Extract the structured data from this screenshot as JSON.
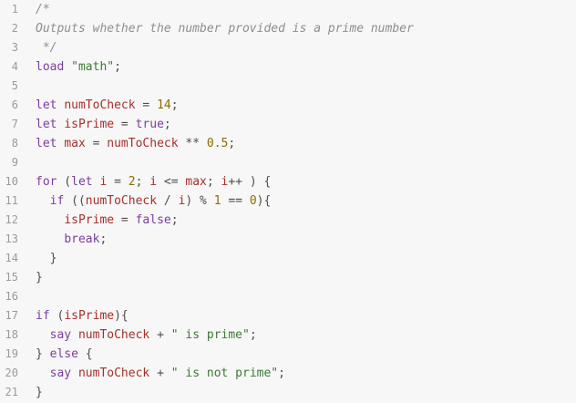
{
  "editor": {
    "lines": [
      {
        "num": "1",
        "tokens": [
          {
            "t": "comment",
            "v": "/*"
          }
        ]
      },
      {
        "num": "2",
        "tokens": [
          {
            "t": "comment",
            "v": "Outputs whether the number provided is a prime number"
          }
        ]
      },
      {
        "num": "3",
        "tokens": [
          {
            "t": "comment",
            "v": " */"
          }
        ]
      },
      {
        "num": "4",
        "tokens": [
          {
            "t": "keyword",
            "v": "load"
          },
          {
            "t": "punct",
            "v": " "
          },
          {
            "t": "string",
            "v": "\"math\""
          },
          {
            "t": "punct",
            "v": ";"
          }
        ]
      },
      {
        "num": "5",
        "tokens": []
      },
      {
        "num": "6",
        "tokens": [
          {
            "t": "keyword",
            "v": "let"
          },
          {
            "t": "punct",
            "v": " "
          },
          {
            "t": "var",
            "v": "numToCheck"
          },
          {
            "t": "op",
            "v": " = "
          },
          {
            "t": "number",
            "v": "14"
          },
          {
            "t": "punct",
            "v": ";"
          }
        ]
      },
      {
        "num": "7",
        "tokens": [
          {
            "t": "keyword",
            "v": "let"
          },
          {
            "t": "punct",
            "v": " "
          },
          {
            "t": "var",
            "v": "isPrime"
          },
          {
            "t": "op",
            "v": " = "
          },
          {
            "t": "bool",
            "v": "true"
          },
          {
            "t": "punct",
            "v": ";"
          }
        ]
      },
      {
        "num": "8",
        "tokens": [
          {
            "t": "keyword",
            "v": "let"
          },
          {
            "t": "punct",
            "v": " "
          },
          {
            "t": "var",
            "v": "max"
          },
          {
            "t": "op",
            "v": " = "
          },
          {
            "t": "var",
            "v": "numToCheck"
          },
          {
            "t": "op",
            "v": " ** "
          },
          {
            "t": "number",
            "v": "0.5"
          },
          {
            "t": "punct",
            "v": ";"
          }
        ]
      },
      {
        "num": "9",
        "tokens": []
      },
      {
        "num": "10",
        "tokens": [
          {
            "t": "keyword",
            "v": "for"
          },
          {
            "t": "punct",
            "v": " ("
          },
          {
            "t": "keyword",
            "v": "let"
          },
          {
            "t": "punct",
            "v": " "
          },
          {
            "t": "var",
            "v": "i"
          },
          {
            "t": "op",
            "v": " = "
          },
          {
            "t": "number",
            "v": "2"
          },
          {
            "t": "punct",
            "v": "; "
          },
          {
            "t": "var",
            "v": "i"
          },
          {
            "t": "op",
            "v": " <= "
          },
          {
            "t": "var",
            "v": "max"
          },
          {
            "t": "punct",
            "v": "; "
          },
          {
            "t": "var",
            "v": "i"
          },
          {
            "t": "op",
            "v": "++"
          },
          {
            "t": "punct",
            "v": " ) {"
          }
        ]
      },
      {
        "num": "11",
        "tokens": [
          {
            "t": "punct",
            "v": "  "
          },
          {
            "t": "keyword",
            "v": "if"
          },
          {
            "t": "punct",
            "v": " (("
          },
          {
            "t": "var",
            "v": "numToCheck"
          },
          {
            "t": "op",
            "v": " / "
          },
          {
            "t": "var",
            "v": "i"
          },
          {
            "t": "punct",
            "v": ")"
          },
          {
            "t": "op",
            "v": " % "
          },
          {
            "t": "number",
            "v": "1"
          },
          {
            "t": "op",
            "v": " == "
          },
          {
            "t": "number",
            "v": "0"
          },
          {
            "t": "punct",
            "v": "){"
          }
        ]
      },
      {
        "num": "12",
        "tokens": [
          {
            "t": "punct",
            "v": "    "
          },
          {
            "t": "var",
            "v": "isPrime"
          },
          {
            "t": "op",
            "v": " = "
          },
          {
            "t": "bool",
            "v": "false"
          },
          {
            "t": "punct",
            "v": ";"
          }
        ]
      },
      {
        "num": "13",
        "tokens": [
          {
            "t": "punct",
            "v": "    "
          },
          {
            "t": "keyword",
            "v": "break"
          },
          {
            "t": "punct",
            "v": ";"
          }
        ]
      },
      {
        "num": "14",
        "tokens": [
          {
            "t": "punct",
            "v": "  }"
          }
        ]
      },
      {
        "num": "15",
        "tokens": [
          {
            "t": "punct",
            "v": "}"
          }
        ]
      },
      {
        "num": "16",
        "tokens": []
      },
      {
        "num": "17",
        "tokens": [
          {
            "t": "keyword",
            "v": "if"
          },
          {
            "t": "punct",
            "v": " ("
          },
          {
            "t": "var",
            "v": "isPrime"
          },
          {
            "t": "punct",
            "v": "){"
          }
        ]
      },
      {
        "num": "18",
        "tokens": [
          {
            "t": "punct",
            "v": "  "
          },
          {
            "t": "keyword",
            "v": "say"
          },
          {
            "t": "punct",
            "v": " "
          },
          {
            "t": "var",
            "v": "numToCheck"
          },
          {
            "t": "op",
            "v": " + "
          },
          {
            "t": "string",
            "v": "\" is prime\""
          },
          {
            "t": "punct",
            "v": ";"
          }
        ]
      },
      {
        "num": "19",
        "tokens": [
          {
            "t": "punct",
            "v": "} "
          },
          {
            "t": "keyword",
            "v": "else"
          },
          {
            "t": "punct",
            "v": " {"
          }
        ]
      },
      {
        "num": "20",
        "tokens": [
          {
            "t": "punct",
            "v": "  "
          },
          {
            "t": "keyword",
            "v": "say"
          },
          {
            "t": "punct",
            "v": " "
          },
          {
            "t": "var",
            "v": "numToCheck"
          },
          {
            "t": "op",
            "v": " + "
          },
          {
            "t": "string",
            "v": "\" is not prime\""
          },
          {
            "t": "punct",
            "v": ";"
          }
        ]
      },
      {
        "num": "21",
        "tokens": [
          {
            "t": "punct",
            "v": "}"
          }
        ]
      }
    ]
  },
  "colors": {
    "background": "#f7f7f7",
    "line_number": "#9a9a9a",
    "comment": "#8e8e8e",
    "keyword": "#7a3e9d",
    "variable": "#a3302b",
    "string": "#3c7a34",
    "number": "#8a6d00"
  }
}
